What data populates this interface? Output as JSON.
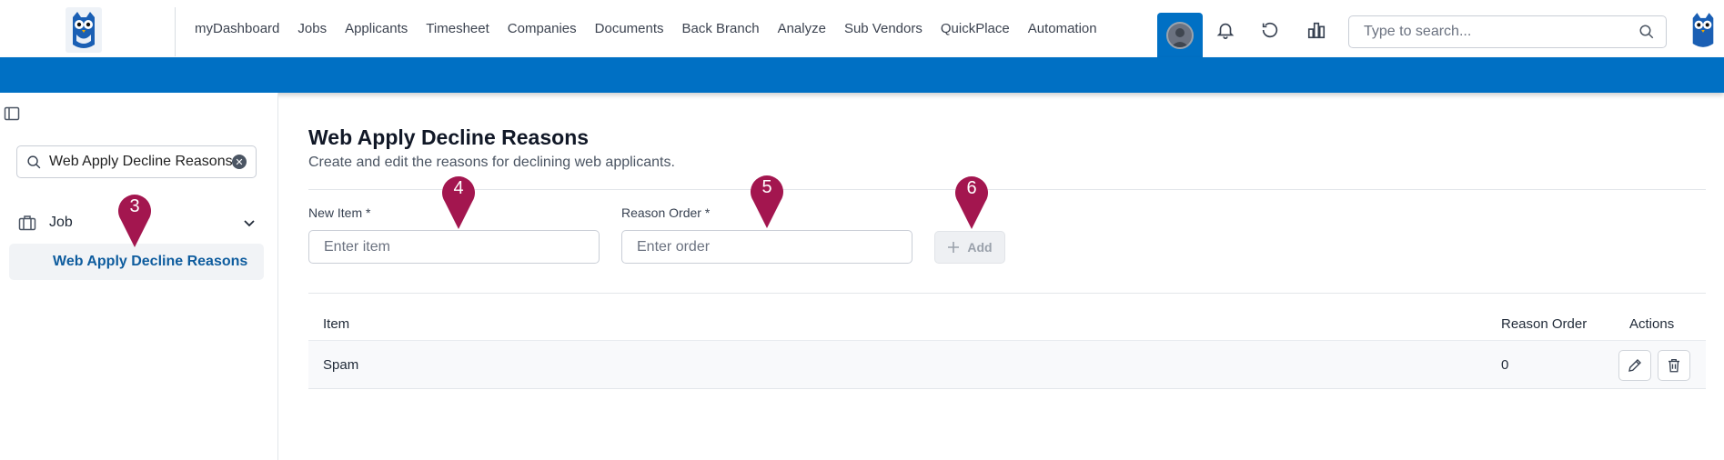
{
  "nav": {
    "items": [
      "myDashboard",
      "Jobs",
      "Applicants",
      "Timesheet",
      "Companies",
      "Documents",
      "Back Branch",
      "Analyze",
      "Sub Vendors",
      "QuickPlace",
      "Automation"
    ]
  },
  "header": {
    "search_placeholder": "Type to search..."
  },
  "sidebar": {
    "search_value": "Web Apply Decline Reasons",
    "group_label": "Job",
    "active_item": "Web Apply Decline Reasons"
  },
  "page": {
    "title": "Web Apply Decline Reasons",
    "subtitle": "Create and edit the reasons for declining web applicants."
  },
  "form": {
    "item_label": "New Item *",
    "item_placeholder": "Enter item",
    "order_label": "Reason Order *",
    "order_placeholder": "Enter order",
    "add_label": "Add"
  },
  "table": {
    "headers": {
      "item": "Item",
      "order": "Reason Order",
      "actions": "Actions"
    },
    "rows": [
      {
        "item": "Spam",
        "order": "0"
      }
    ]
  },
  "markers": [
    "3",
    "4",
    "5",
    "6"
  ],
  "colors": {
    "brand_blue": "#0070c4",
    "marker": "#a3164f",
    "link": "#0e5c9e"
  }
}
